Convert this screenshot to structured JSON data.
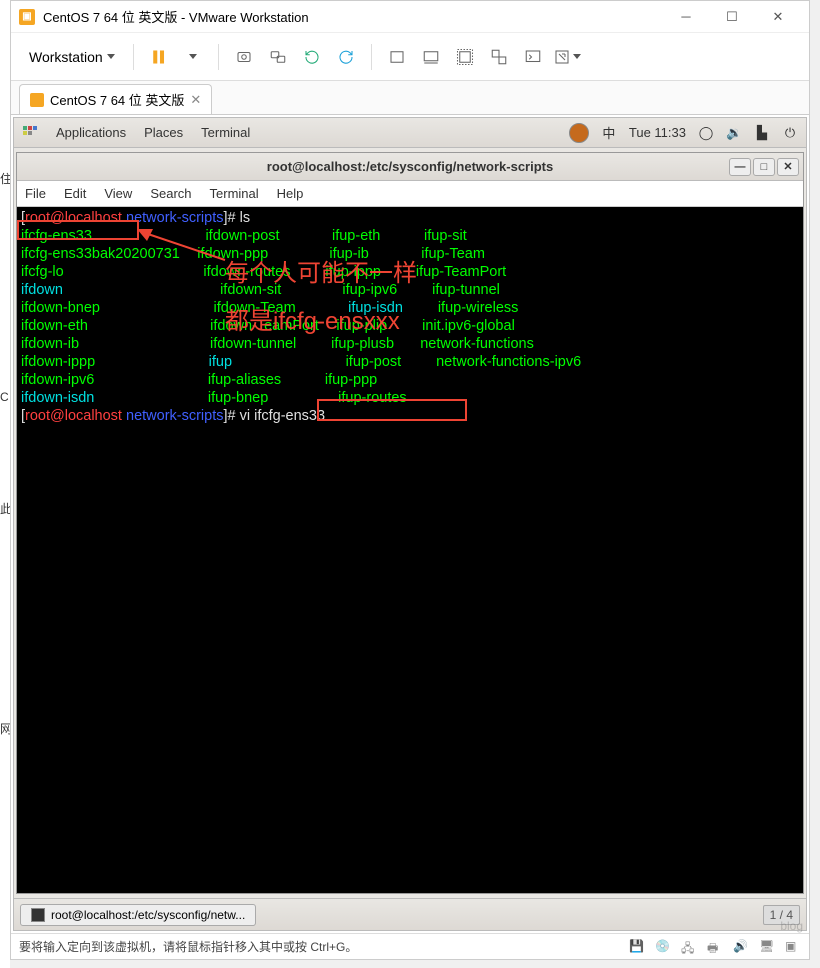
{
  "vmware": {
    "title": "CentOS 7 64 位 英文版 - VMware Workstation",
    "menu_label": "Workstation",
    "tab_label": "CentOS 7 64 位 英文版",
    "status_hint": "要将输入定向到该虚拟机，请将鼠标指针移入其中或按 Ctrl+G。"
  },
  "gnome": {
    "apps": "Applications",
    "places": "Places",
    "terminal": "Terminal",
    "ime": "中",
    "clock": "Tue 11:33",
    "workspace": "1 / 4",
    "task": "root@localhost:/etc/sysconfig/netw..."
  },
  "term": {
    "title": "root@localhost:/etc/sysconfig/network-scripts",
    "menu": [
      "File",
      "Edit",
      "View",
      "Search",
      "Terminal",
      "Help"
    ],
    "prompt_user": "root@localhost",
    "prompt_dir": "network-scripts",
    "cmd1": "ls",
    "cmd2": "vi ifcfg-ens33",
    "files": {
      "col1": [
        "ifcfg-ens33",
        "ifcfg-ens33bak20200731",
        "ifcfg-lo",
        "ifdown",
        "ifdown-bnep",
        "ifdown-eth",
        "ifdown-ib",
        "ifdown-ippp",
        "ifdown-ipv6",
        "ifdown-isdn"
      ],
      "col2": [
        "ifdown-post",
        "ifdown-ppp",
        "ifdown-routes",
        "ifdown-sit",
        "ifdown-Team",
        "ifdown-TeamPort",
        "ifdown-tunnel",
        "ifup",
        "ifup-aliases",
        "ifup-bnep"
      ],
      "col3": [
        "ifup-eth",
        "ifup-ib",
        "ifup-ippp",
        "ifup-ipv6",
        "ifup-isdn",
        "ifup-plip",
        "ifup-plusb",
        "ifup-post",
        "ifup-ppp",
        "ifup-routes"
      ],
      "col4": [
        "ifup-sit",
        "ifup-Team",
        "ifup-TeamPort",
        "ifup-tunnel",
        "ifup-wireless",
        "init.ipv6-global",
        "network-functions",
        "network-functions-ipv6"
      ]
    }
  },
  "annotation": {
    "line1": "每个人可能不一样",
    "line2": "都是ifcfg-ensxxx"
  }
}
